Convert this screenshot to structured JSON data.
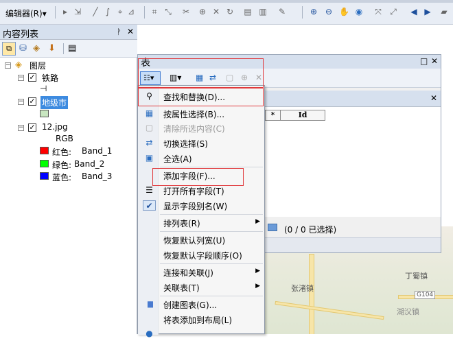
{
  "toolbar": {
    "editor_label": "编辑器(R)▾"
  },
  "toc": {
    "title": "内容列表",
    "pin_glyph": "ᚹ",
    "close_glyph": "✕",
    "root_layer": "图层",
    "layers": [
      {
        "name": "铁路",
        "checked": true,
        "symbol": "⊣"
      },
      {
        "name": "地级市",
        "checked": true,
        "selected": true,
        "fill": "#c8e6c0"
      },
      {
        "name": "12.jpg",
        "checked": true
      }
    ],
    "rgb_label": "RGB",
    "bands": [
      {
        "color": "#ff0000",
        "label": "红色:",
        "band": "Band_1"
      },
      {
        "color": "#00ff00",
        "label": "绿色:",
        "band": "Band_2"
      },
      {
        "color": "#0000ff",
        "label": "蓝色:",
        "band": "Band_3"
      }
    ]
  },
  "table_window": {
    "title": "表",
    "pin_glyph": "□",
    "close_glyph": "✕",
    "inner_close_glyph": "✕",
    "columns": [
      "*",
      "Id"
    ],
    "selection_status": "(0 / 0 已选择)"
  },
  "menu": {
    "items": [
      {
        "label": "查找和替换(D)...",
        "icon": "binoculars-icon",
        "glyph": "🔍",
        "disabled": false
      },
      {
        "label": "按属性选择(B)...",
        "icon": "select-by-attributes-icon",
        "glyph": "▦",
        "disabled": false
      },
      {
        "label": "清除所选内容(C)",
        "icon": "clear-selection-icon",
        "glyph": "▢",
        "disabled": true
      },
      {
        "label": "切换选择(S)",
        "icon": "switch-selection-icon",
        "glyph": "⇄",
        "disabled": false
      },
      {
        "label": "全选(A)",
        "icon": "select-all-icon",
        "glyph": "▣",
        "disabled": false
      },
      {
        "label": "添加字段(F)...",
        "icon": "",
        "glyph": "",
        "disabled": false
      },
      {
        "label": "打开所有字段(T)",
        "icon": "all-fields-icon",
        "glyph": "☰",
        "disabled": false
      },
      {
        "label": "显示字段别名(W)",
        "icon": "checkmark-icon",
        "glyph": "✔",
        "disabled": false
      },
      {
        "label": "排列表(R)",
        "icon": "",
        "glyph": "",
        "disabled": false,
        "submenu": true
      },
      {
        "label": "恢复默认列宽(U)",
        "icon": "",
        "glyph": "",
        "disabled": false
      },
      {
        "label": "恢复默认字段顺序(O)",
        "icon": "",
        "glyph": "",
        "disabled": false
      },
      {
        "label": "连接和关联(J)",
        "icon": "",
        "glyph": "",
        "disabled": false,
        "submenu": true
      },
      {
        "label": "关联表(T)",
        "icon": "",
        "glyph": "",
        "disabled": false,
        "submenu": true
      },
      {
        "label": "创建图表(G)...",
        "icon": "chart-icon",
        "glyph": "▮",
        "disabled": false
      },
      {
        "label": "将表添加到布局(L)",
        "icon": "",
        "glyph": "",
        "disabled": false
      }
    ]
  },
  "map": {
    "labels": [
      "张渚镇",
      "湖㳇镇",
      "丁蜀镇",
      "G104"
    ]
  }
}
